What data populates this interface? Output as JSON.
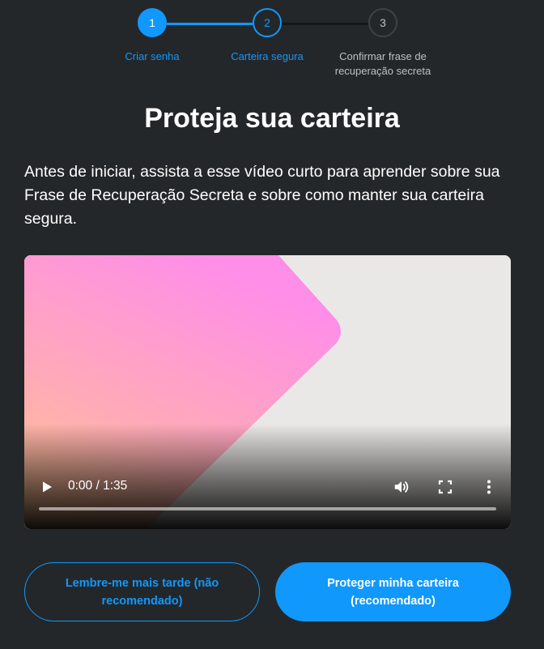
{
  "stepper": {
    "steps": [
      {
        "number": "1",
        "label": "Criar senha",
        "state": "complete"
      },
      {
        "number": "2",
        "label": "Carteira segura",
        "state": "active"
      },
      {
        "number": "3",
        "label": "Confirmar frase de recuperação secreta",
        "state": "pending"
      }
    ],
    "colors": {
      "accent": "#1098fc",
      "inactive_line": "#141618",
      "inactive_border": "#3e4247"
    }
  },
  "main": {
    "title": "Proteja sua carteira",
    "description": "Antes de iniciar, assista a esse vídeo curto para aprender sobre sua Frase de Recuperação Secreta e sobre como manter sua carteira segura."
  },
  "video": {
    "time": "0:00 / 1:35",
    "progress_fraction": 0,
    "icons": {
      "play": "play-icon",
      "volume": "volume-icon",
      "fullscreen": "fullscreen-icon",
      "more": "more-vertical-icon"
    }
  },
  "actions": {
    "remind_later_label": "Lembre-me mais tarde (não recomendado)",
    "secure_wallet_label": "Proteger minha carteira (recomendado)"
  },
  "theme": {
    "background": "#24272a",
    "accent": "#1098fc",
    "text": "#ffffff",
    "muted_text": "#bbc0c5"
  }
}
